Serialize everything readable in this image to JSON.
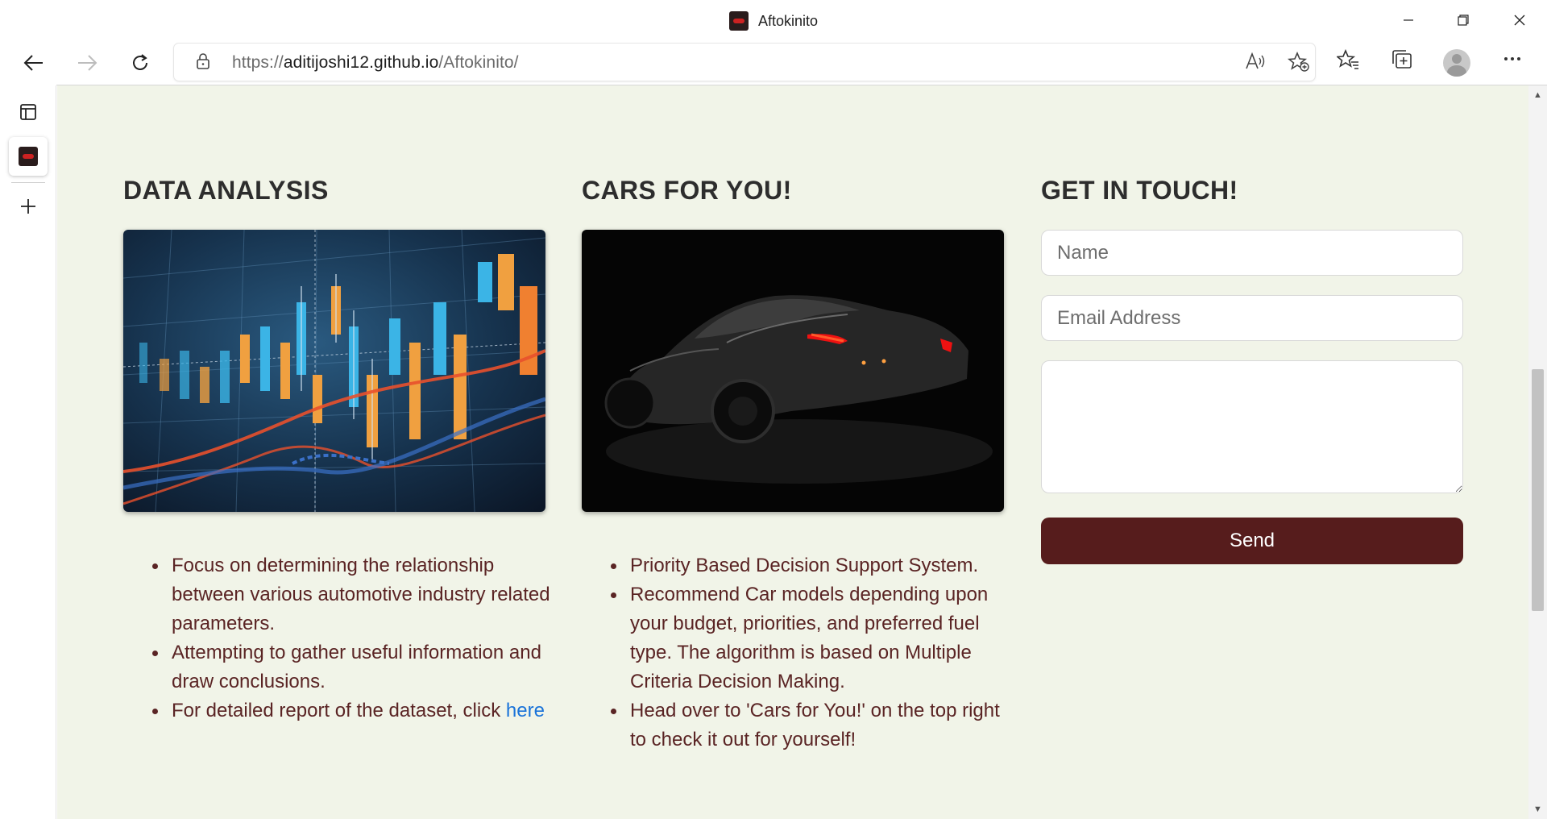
{
  "window": {
    "title": "Aftokinito",
    "minimize_icon": "minimize-icon",
    "restore_icon": "restore-icon",
    "close_icon": "close-icon"
  },
  "toolbar": {
    "url_prefix": "https://",
    "url_host": "aditijoshi12.github.io",
    "url_path": "/Aftokinito/",
    "icons": [
      "back-icon",
      "forward-icon",
      "refresh-icon",
      "lock-icon",
      "read-aloud-icon",
      "add-favorite-icon",
      "favorites-icon",
      "collections-icon",
      "profile-icon",
      "more-icon"
    ]
  },
  "sidebar": {
    "icons": [
      "tab-actions-icon",
      "site-tab-favicon",
      "new-tab-icon"
    ]
  },
  "sections": {
    "data_analysis": {
      "title": "DATA ANALYSIS",
      "bullets": [
        "Focus on determining the relationship between various automotive industry related parameters.",
        "Attempting to gather useful information and draw conclusions."
      ],
      "report_text": "For detailed report of the dataset, click ",
      "report_link": "here"
    },
    "cars_for_you": {
      "title": "CARS FOR YOU!",
      "bullets": [
        "Priority Based Decision Support System.",
        "Recommend Car models depending upon your budget, priorities, and preferred fuel type. The algorithm is based on Multiple Criteria Decision Making.",
        "Head over to 'Cars for You!' on the top right to check it out for yourself!"
      ]
    },
    "get_in_touch": {
      "title": "GET IN TOUCH!",
      "name_placeholder": "Name",
      "email_placeholder": "Email Address",
      "message_value": "",
      "send_label": "Send"
    }
  },
  "colors": {
    "page_background": "#f1f4e8",
    "heading": "#2d2d2d",
    "bullet_text": "#5a2424",
    "link": "#1a73d9",
    "send_button": "#561c1c"
  }
}
